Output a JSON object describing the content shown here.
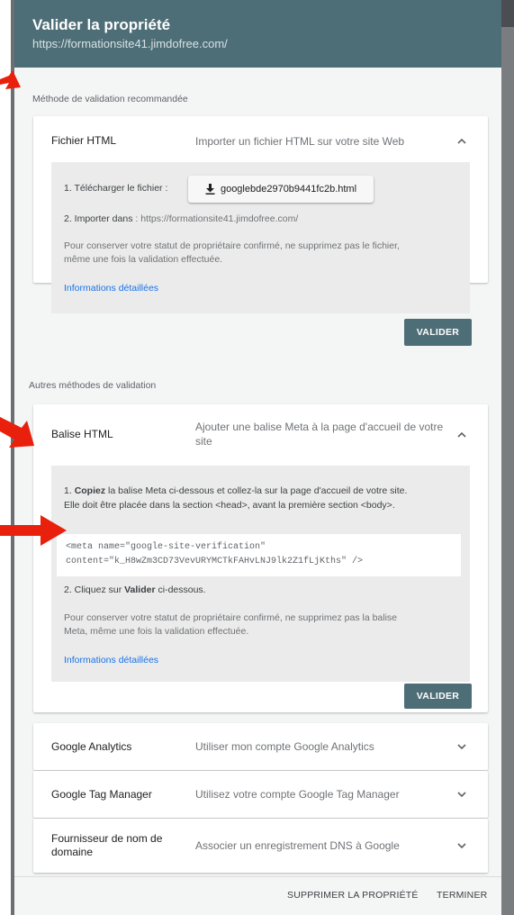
{
  "header": {
    "title": "Valider la propriété",
    "url": "https://formationsite41.jimdofree.com/"
  },
  "recommended_label": "Méthode de validation recommandée",
  "other_label": "Autres méthodes de validation",
  "html_file": {
    "name": "Fichier HTML",
    "description": "Importer un fichier HTML sur votre site Web",
    "step1_label": "1. Télécharger le fichier :",
    "download_filename": "googlebde2970b9441fc2b.html",
    "step2_bold": "2. Importer dans",
    "step2_rest": " : https://formationsite41.jimdofree.com/",
    "note_line1": "Pour conserver votre statut de propriétaire confirmé, ne supprimez pas le fichier,",
    "note_line2": "même une fois la validation effectuée.",
    "more_info": "Informations détaillées",
    "validate": "VALIDER"
  },
  "html_tag": {
    "name": "Balise HTML",
    "description": "Ajouter une balise Meta à la page d'accueil de votre site",
    "step1_num": "1. ",
    "step1_bold": "Copiez",
    "step1_rest": " la balise Meta ci-dessous et collez-la sur la page d'accueil de votre site.",
    "step1_line2": "Elle doit être placée dans la section <head>, avant la première section <body>.",
    "code_line1": "<meta name=\"google-site-verification\"",
    "code_line2": "content=\"k_H8wZm3CD73VevURYMCTkFAHvLNJ9lk2Z1fLjKths\" />",
    "step2_pre": "2. Cliquez sur ",
    "step2_bold": "Valider",
    "step2_post": " ci-dessous.",
    "note_line1": "Pour conserver votre statut de propriétaire confirmé, ne supprimez pas la balise",
    "note_line2": "Meta, même une fois la validation effectuée.",
    "more_info": "Informations détaillées",
    "validate": "VALIDER"
  },
  "collapsed_methods": [
    {
      "name": "Google Analytics",
      "description": "Utiliser mon compte Google Analytics"
    },
    {
      "name": "Google Tag Manager",
      "description": "Utilisez votre compte Google Tag Manager"
    },
    {
      "name": "Fournisseur de nom de domaine",
      "description": "Associer un enregistrement DNS à Google"
    }
  ],
  "footer": {
    "delete_property": "SUPPRIMER LA PROPRIÉTÉ",
    "finish": "TERMINER"
  },
  "colors": {
    "header_bg": "#4e6e77",
    "accent_button": "#4e6e77",
    "link": "#1a73e8",
    "annotation_arrow": "#e8200c"
  }
}
